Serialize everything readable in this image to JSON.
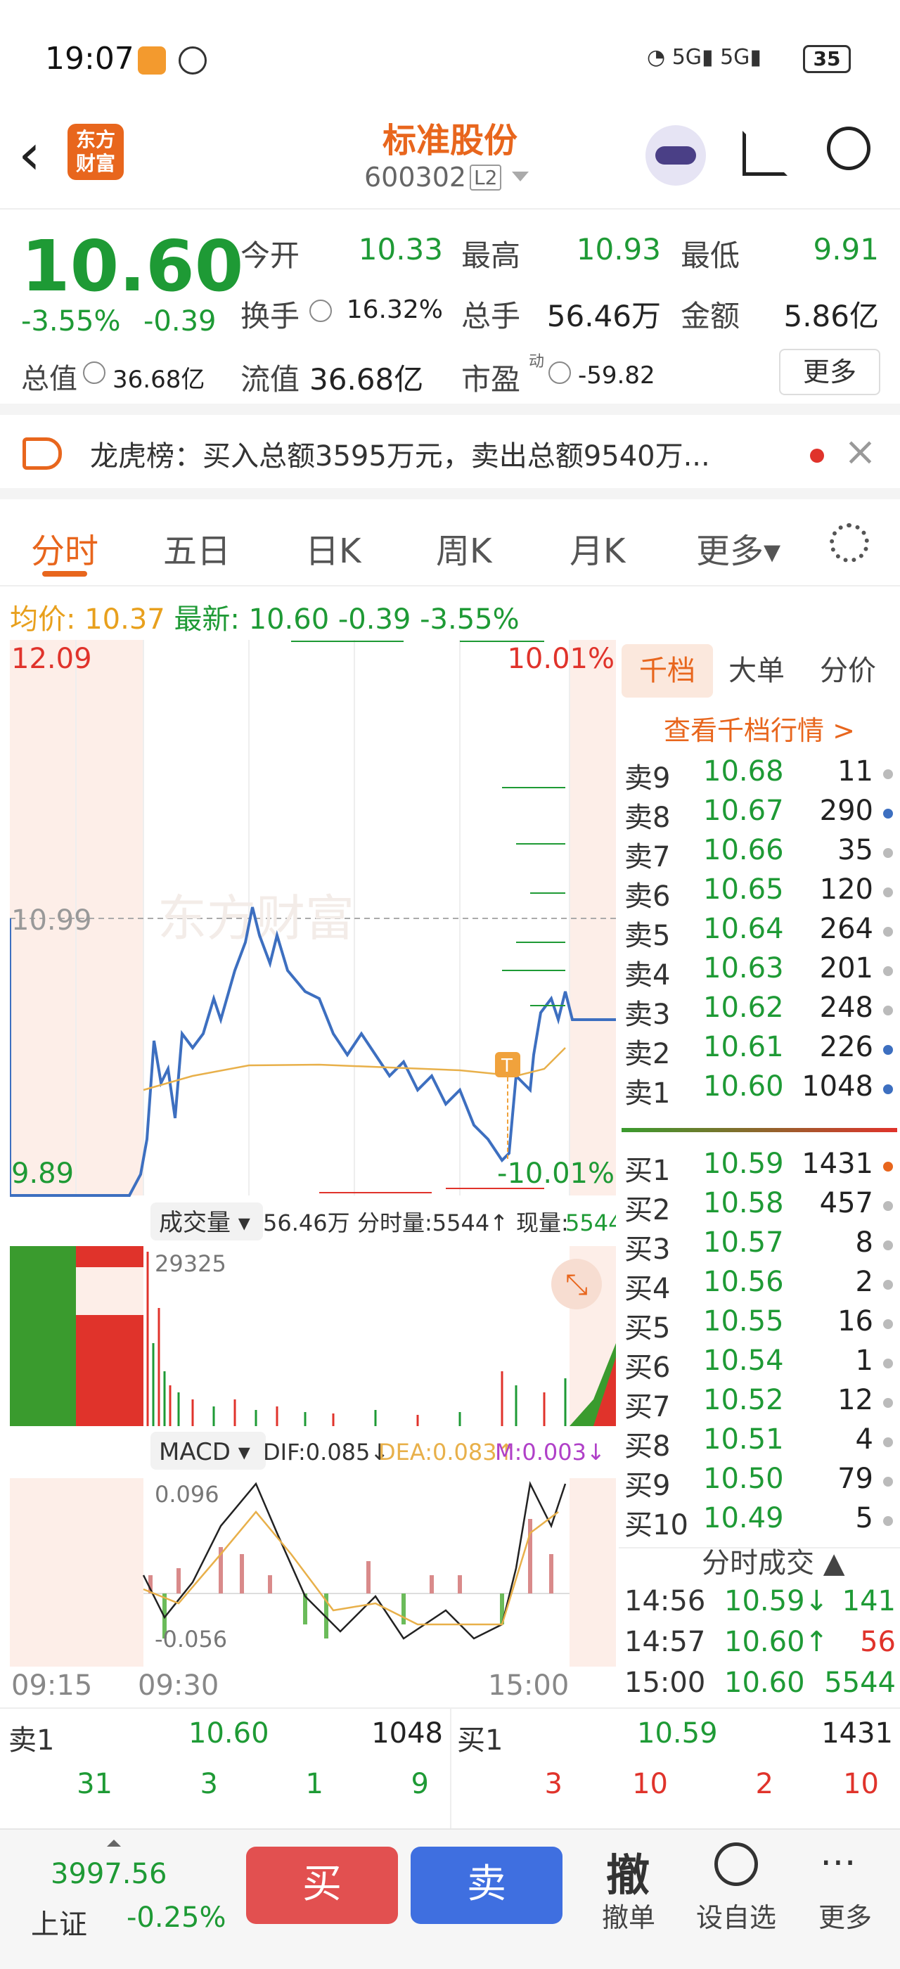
{
  "status": {
    "time": "19:07",
    "battery": "35"
  },
  "header": {
    "name": "标准股份",
    "code": "600302",
    "level": "L2",
    "logo_line1": "东方",
    "logo_line2": "财富"
  },
  "quote": {
    "price": "10.60",
    "pct": "-3.55%",
    "chg": "-0.39",
    "open_label": "今开",
    "open": "10.33",
    "high_label": "最高",
    "high": "10.93",
    "low_label": "最低",
    "low": "9.91",
    "turnover_label": "换手",
    "turnover": "16.32%",
    "vol_label": "总手",
    "vol": "56.46万",
    "amount_label": "金额",
    "amount": "5.86亿",
    "mcap_label": "总值",
    "mcap": "36.68亿",
    "float_label": "流值",
    "float": "36.68亿",
    "pe_label": "市盈",
    "pe_sup": "动",
    "pe": "-59.82",
    "more": "更多"
  },
  "notice": {
    "text": "龙虎榜：买入总额3595万元，卖出总额9540万..."
  },
  "tabs": [
    "分时",
    "五日",
    "日K",
    "周K",
    "月K",
    "更多▾"
  ],
  "avg": {
    "avg_label": "均价:",
    "avg_val": "10.37",
    "last_label": "最新:",
    "last_val": "10.60",
    "chg": "-0.39",
    "pct": "-3.55%"
  },
  "chart": {
    "price_high": "12.09",
    "price_mid": "10.99",
    "price_low": "9.89",
    "pct_high": "10.01%",
    "pct_low": "-10.01%",
    "watermark": "东方财富",
    "vol_label": "成交量 ▾",
    "vol_total": "56.46万",
    "vol_period": "分时量:5544↑",
    "vol_now_label": "现量:",
    "vol_now": "5544",
    "vol_max": "29325",
    "macd_label": "MACD ▾",
    "dif": "DIF:0.085↓",
    "dea": "DEA:0.083↑",
    "m": "M:0.003↓",
    "macd_high": "0.096",
    "macd_low": "-0.056",
    "t_start": "09:15",
    "t_open": "09:30",
    "t_end": "15:00",
    "t_marker": "T"
  },
  "book": {
    "tabs": [
      "千档",
      "大单",
      "分价"
    ],
    "link": "查看千档行情 >",
    "asks": [
      [
        "卖9",
        "10.68",
        "11"
      ],
      [
        "卖8",
        "10.67",
        "290"
      ],
      [
        "卖7",
        "10.66",
        "35"
      ],
      [
        "卖6",
        "10.65",
        "120"
      ],
      [
        "卖5",
        "10.64",
        "264"
      ],
      [
        "卖4",
        "10.63",
        "201"
      ],
      [
        "卖3",
        "10.62",
        "248"
      ],
      [
        "卖2",
        "10.61",
        "226"
      ],
      [
        "卖1",
        "10.60",
        "1048"
      ]
    ],
    "bids": [
      [
        "买1",
        "10.59",
        "1431"
      ],
      [
        "买2",
        "10.58",
        "457"
      ],
      [
        "买3",
        "10.57",
        "8"
      ],
      [
        "买4",
        "10.56",
        "2"
      ],
      [
        "买5",
        "10.55",
        "16"
      ],
      [
        "买6",
        "10.54",
        "1"
      ],
      [
        "买7",
        "10.52",
        "12"
      ],
      [
        "买8",
        "10.51",
        "4"
      ],
      [
        "买9",
        "10.50",
        "79"
      ],
      [
        "买10",
        "10.49",
        "5"
      ]
    ],
    "ticks_title": "分时成交 ▲",
    "ticks": [
      [
        "14:56",
        "10.59↓",
        "141"
      ],
      [
        "14:57",
        "10.60↑",
        "56"
      ],
      [
        "15:00",
        "10.60",
        "5544"
      ]
    ]
  },
  "bottom": {
    "ask_label": "卖1",
    "ask_price": "10.60",
    "ask_vol": "1048",
    "bid_label": "买1",
    "bid_price": "10.59",
    "bid_vol": "1431",
    "ask_orders": [
      "31",
      "3",
      "1",
      "9"
    ],
    "bid_orders": [
      "3",
      "10",
      "2",
      "10"
    ]
  },
  "footer": {
    "index_val": "3997.56",
    "index_name": "上证",
    "index_pct": "-0.25%",
    "buy": "买",
    "sell": "卖",
    "cancel_icon": "撤",
    "cancel": "撤单",
    "watch": "设自选",
    "more": "更多"
  }
}
